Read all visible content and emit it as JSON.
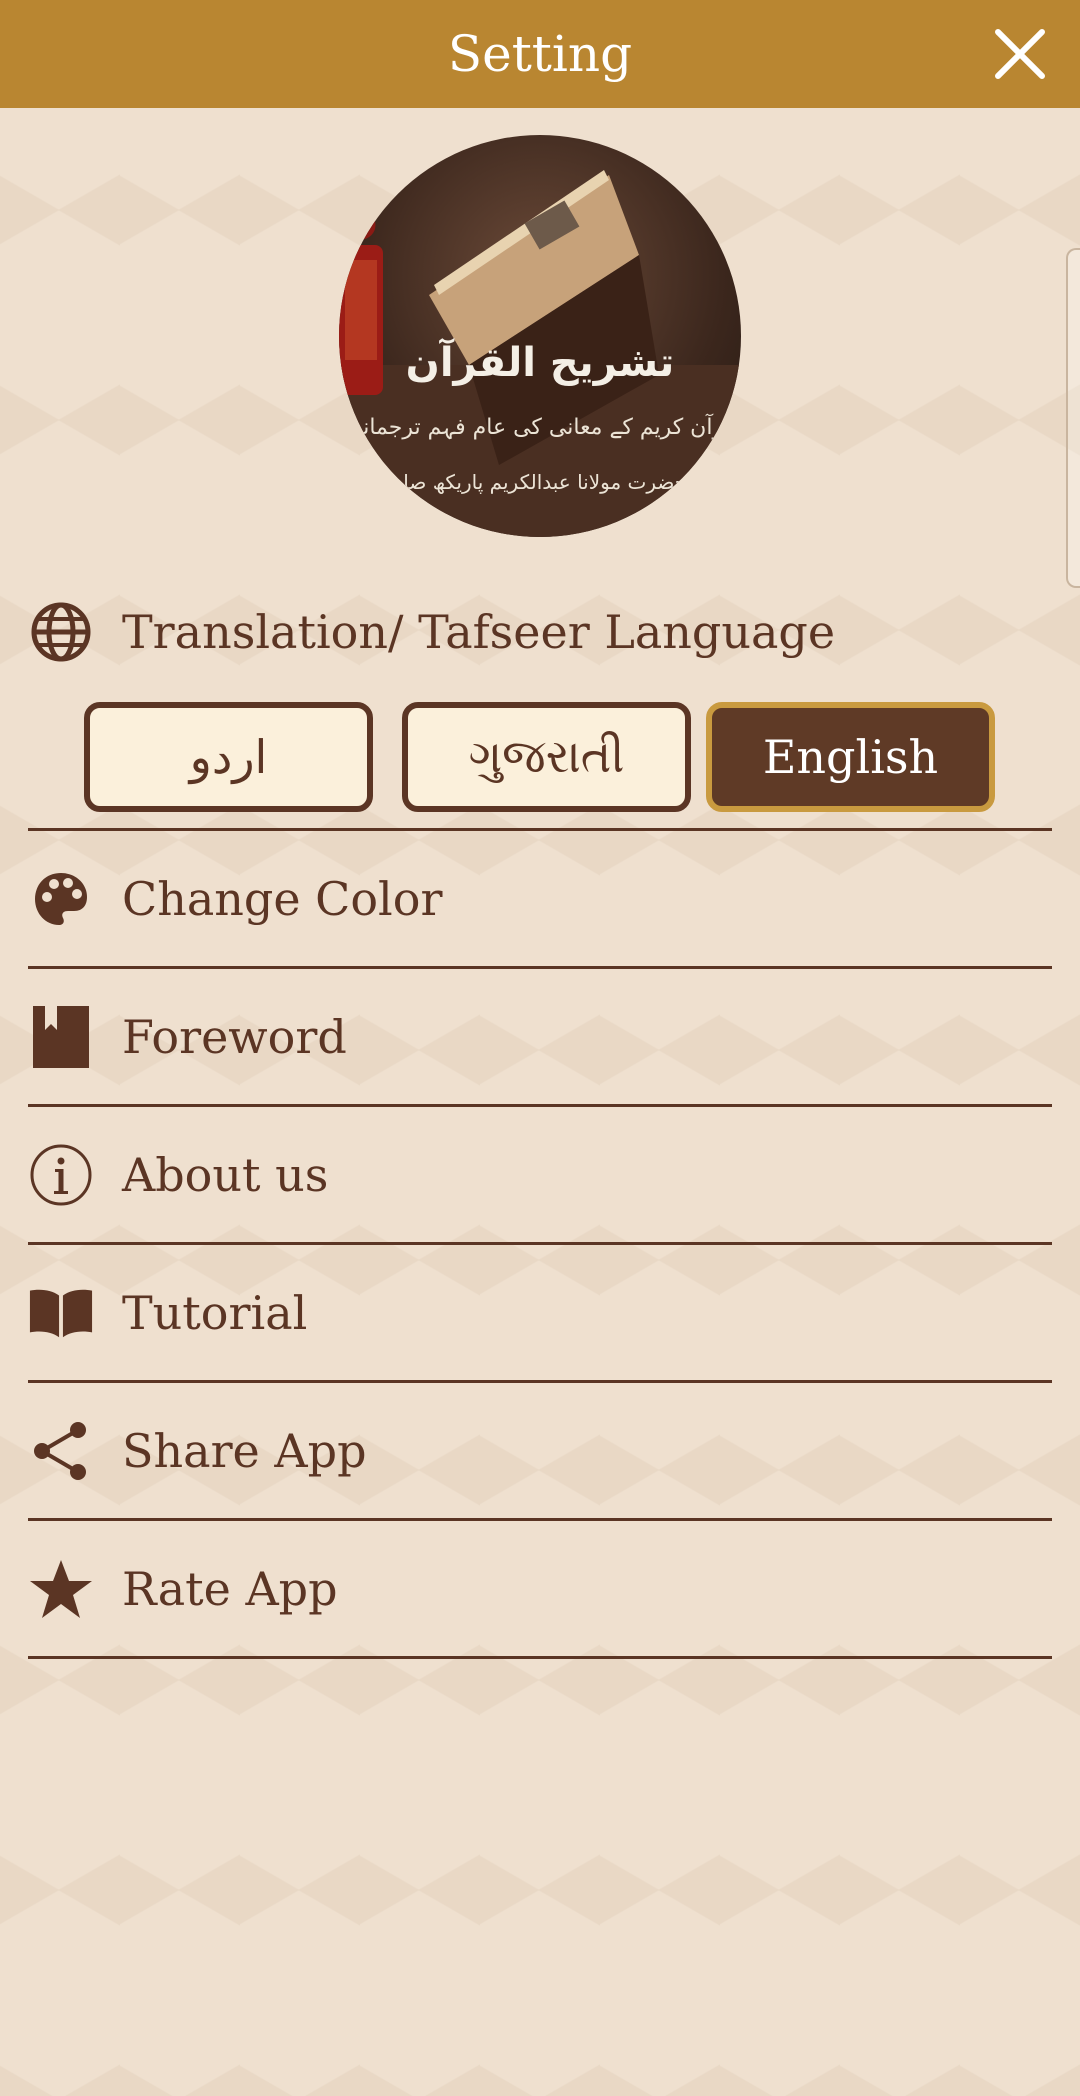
{
  "header": {
    "title": "Setting"
  },
  "logo": {
    "title": "تشریح القرآن",
    "subtitle": "قرآن کریم کے معانی کی عام فہم ترجمانی",
    "author": "از حضرت مولانا عبدالکریم پاریکھ صاحب"
  },
  "language_section": {
    "label": "Translation/ Tafseer Language",
    "options": [
      "اردو",
      "ગુજરાતી",
      "English"
    ],
    "selected": "English"
  },
  "menu": {
    "items": [
      {
        "label": "Change Color",
        "icon": "palette-icon"
      },
      {
        "label": "Foreword",
        "icon": "bookmark-icon"
      },
      {
        "label": "About us",
        "icon": "info-icon"
      },
      {
        "label": "Tutorial",
        "icon": "open-book-icon"
      },
      {
        "label": "Share App",
        "icon": "share-icon"
      },
      {
        "label": "Rate App",
        "icon": "star-icon"
      }
    ]
  },
  "colors": {
    "header": "#b98631",
    "brown": "#5b3524",
    "background": "#efe0cf",
    "active_button": "#5f3a26",
    "active_border": "#c99a3f"
  }
}
